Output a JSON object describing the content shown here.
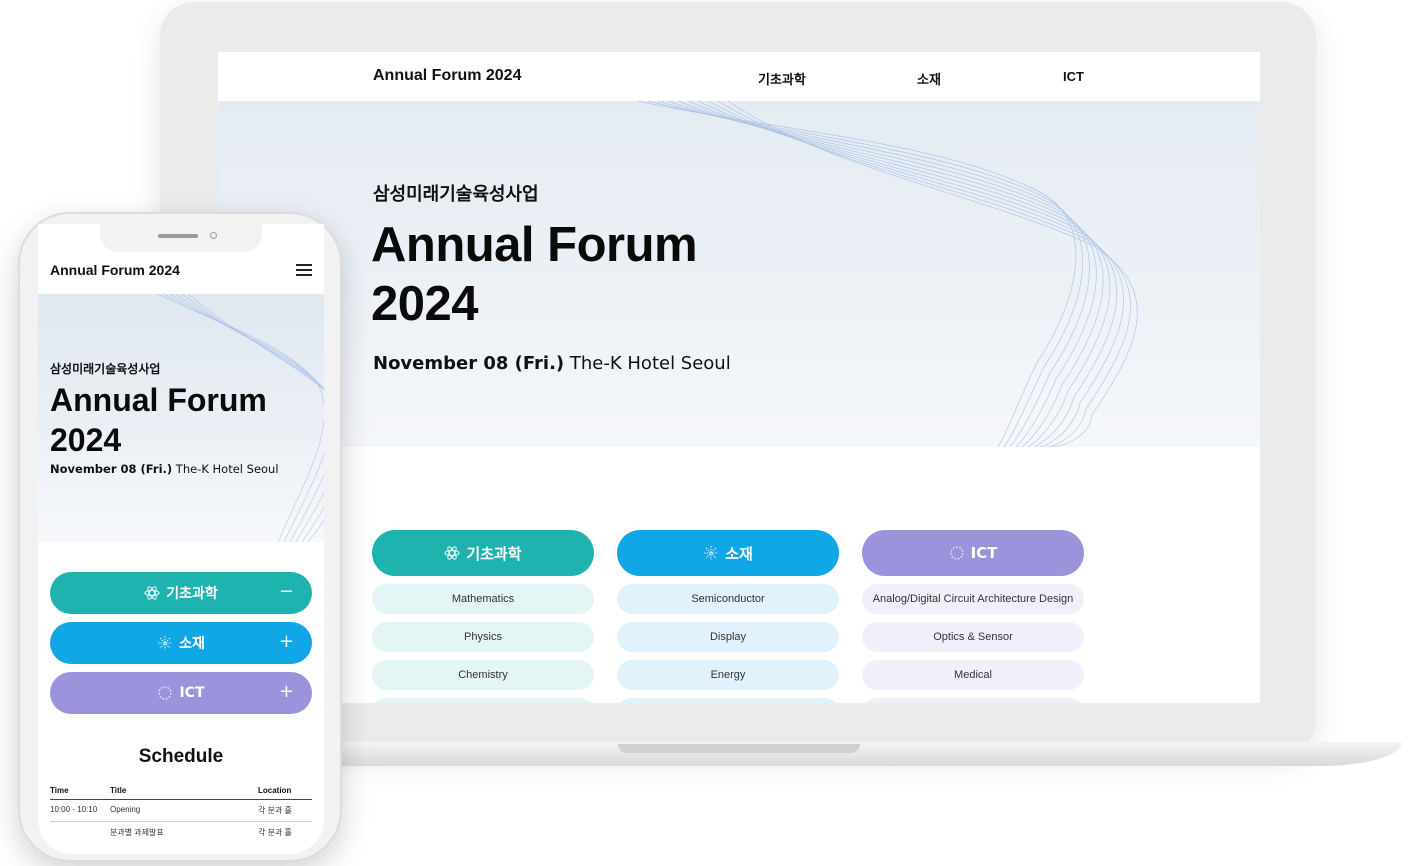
{
  "laptop": {
    "nav": {
      "logo": "Annual Forum 2024",
      "items": [
        "기초과학",
        "소재",
        "ICT"
      ]
    },
    "hero": {
      "kicker": "삼성미래기술육성사업",
      "title": "Annual Forum 2024",
      "date_bold": "November 08 (Fri.)",
      "venue": " The-K Hotel Seoul"
    },
    "categories": [
      {
        "label": "기초과학",
        "icon": "molecule-icon",
        "color": "#1fb3b0",
        "items": [
          "Mathematics",
          "Physics",
          "Chemistry"
        ]
      },
      {
        "label": "소재",
        "icon": "sparkle-icon",
        "color": "#11a6e6",
        "items": [
          "Semiconductor",
          "Display",
          "Energy"
        ]
      },
      {
        "label": "ICT",
        "icon": "circuit-icon",
        "color": "#9b93db",
        "items": [
          "Analog/Digital Circuit Architecture Design",
          "Optics & Sensor",
          "Medical"
        ]
      }
    ]
  },
  "phone": {
    "nav": {
      "logo": "Annual Forum 2024",
      "menu_icon": "hamburger-menu-icon"
    },
    "hero": {
      "kicker": "삼성미래기술육성사업",
      "title": "Annual Forum 2024",
      "date_bold": "November 08 (Fri.)",
      "venue": " The-K Hotel Seoul"
    },
    "accordion": [
      {
        "label": "기초과학",
        "toggle": "−"
      },
      {
        "label": "소재",
        "toggle": "+"
      },
      {
        "label": "ICT",
        "toggle": "+"
      }
    ],
    "schedule": {
      "title": "Schedule",
      "headers": [
        "Time",
        "Title",
        "Location"
      ],
      "rows": [
        [
          "10:00 - 10:10",
          "Opening",
          "각 분과 홀"
        ],
        [
          "",
          "분과별 과제발표",
          "각 분과 홀"
        ]
      ]
    }
  }
}
